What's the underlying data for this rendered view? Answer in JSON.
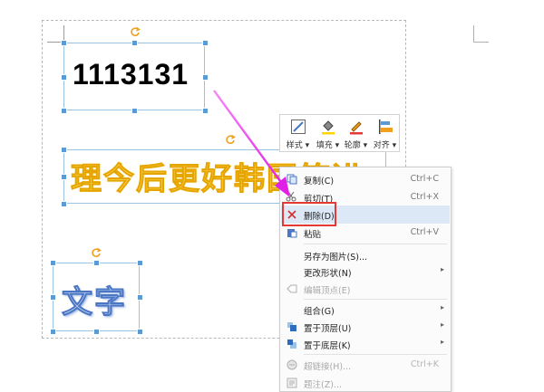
{
  "canvas": {
    "text_box_1": "1113131",
    "text_box_2": "理今后更好韩国笑进",
    "text_box_3": "文字"
  },
  "toolbar": {
    "items": [
      {
        "label": "样式 ▾",
        "icon": "style-icon"
      },
      {
        "label": "填充 ▾",
        "icon": "fill-bucket-icon"
      },
      {
        "label": "轮廓 ▾",
        "icon": "outline-pen-icon"
      },
      {
        "label": "对齐 ▾",
        "icon": "align-icon"
      }
    ]
  },
  "context_menu": {
    "items": [
      {
        "label": "复制(C)",
        "shortcut": "Ctrl+C",
        "icon": "copy-icon"
      },
      {
        "label": "剪切(T)",
        "shortcut": "Ctrl+X",
        "icon": "cut-icon"
      },
      {
        "label": "删除(D)",
        "shortcut": "",
        "icon": "delete-icon"
      },
      {
        "label": "粘贴",
        "shortcut": "Ctrl+V",
        "icon": "paste-icon"
      },
      {
        "label": "另存为图片(S)...",
        "shortcut": "",
        "icon": ""
      },
      {
        "label": "更改形状(N)",
        "shortcut": "",
        "icon": ""
      },
      {
        "label": "编辑顶点(E)",
        "shortcut": "",
        "icon": "edit-points-icon"
      },
      {
        "label": "组合(G)",
        "shortcut": "",
        "icon": ""
      },
      {
        "label": "置于顶层(U)",
        "shortcut": "",
        "icon": "bring-to-front-icon"
      },
      {
        "label": "置于底层(K)",
        "shortcut": "",
        "icon": "send-to-back-icon"
      },
      {
        "label": "超链接(H)...",
        "shortcut": "Ctrl+K",
        "icon": "hyperlink-icon"
      },
      {
        "label": "题注(Z)...",
        "shortcut": "",
        "icon": "caption-icon"
      }
    ]
  },
  "colors": {
    "accent_arrow": "#ee3af0",
    "highlight": "#e53935",
    "selection": "#5b9bd5"
  }
}
